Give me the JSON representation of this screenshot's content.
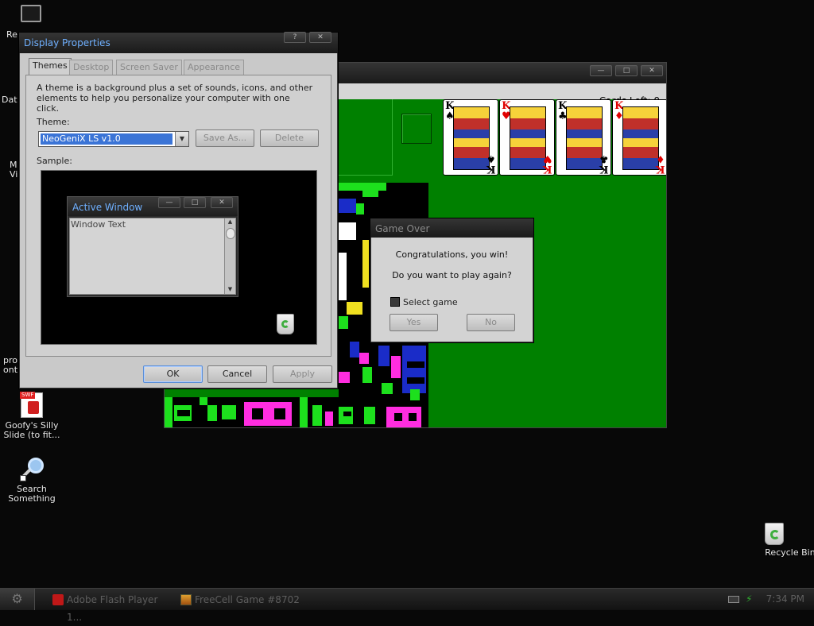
{
  "desktop": {
    "partial_labels": [
      "Re",
      "Dat",
      "M\nVi",
      "pro\nont"
    ],
    "icons": [
      {
        "label": "Goofy's Silly Slide (to fit...",
        "icon": "flash-swf-icon"
      },
      {
        "label": "Search Something",
        "icon": "search-magnifier-icon"
      },
      {
        "label": "Recycle Bin",
        "icon": "recycle-bin-icon"
      }
    ],
    "swf_badge": "SWF"
  },
  "freecell": {
    "cards_left_label": "Cards Left: 0",
    "kings": [
      {
        "rank": "K",
        "suit": "♠",
        "color": "black"
      },
      {
        "rank": "K",
        "suit": "♥",
        "color": "red"
      },
      {
        "rank": "K",
        "suit": "♣",
        "color": "black"
      },
      {
        "rank": "K",
        "suit": "♦",
        "color": "red"
      }
    ],
    "controls": {
      "minimize": "—",
      "maximize": "□",
      "close": "✕"
    }
  },
  "game_over": {
    "title": "Game Over",
    "message1": "Congratulations, you win!",
    "message2": "Do you want to play again?",
    "checkbox_label": "Select game",
    "checkbox_checked": false,
    "yes_label": "Yes",
    "no_label": "No"
  },
  "display_properties": {
    "title": "Display Properties",
    "controls": {
      "help": "?",
      "close": "✕"
    },
    "tabs": [
      "Themes",
      "Desktop",
      "Screen Saver",
      "Appearance"
    ],
    "active_tab": "Themes",
    "description": "A theme is a background plus a set of sounds, icons, and other elements to help you personalize your computer with one click.",
    "theme_label": "Theme:",
    "theme_value": "NeoGeniX LS v1.0",
    "save_as_label": "Save As...",
    "delete_label": "Delete",
    "sample_label": "Sample:",
    "sample_window_title": "Active Window",
    "sample_window_text": "Window Text",
    "ok_label": "OK",
    "cancel_label": "Cancel",
    "apply_label": "Apply"
  },
  "taskbar": {
    "items": [
      {
        "label": "Adobe Flash Player 1...",
        "icon": "flash-player-icon"
      },
      {
        "label": "FreeCell Game #8702",
        "icon": "freecell-icon"
      }
    ],
    "time": "7:34 PM"
  },
  "colors": {
    "felt": "#008000",
    "title_text": "#6fb0ff",
    "selection": "#3b74d6"
  }
}
